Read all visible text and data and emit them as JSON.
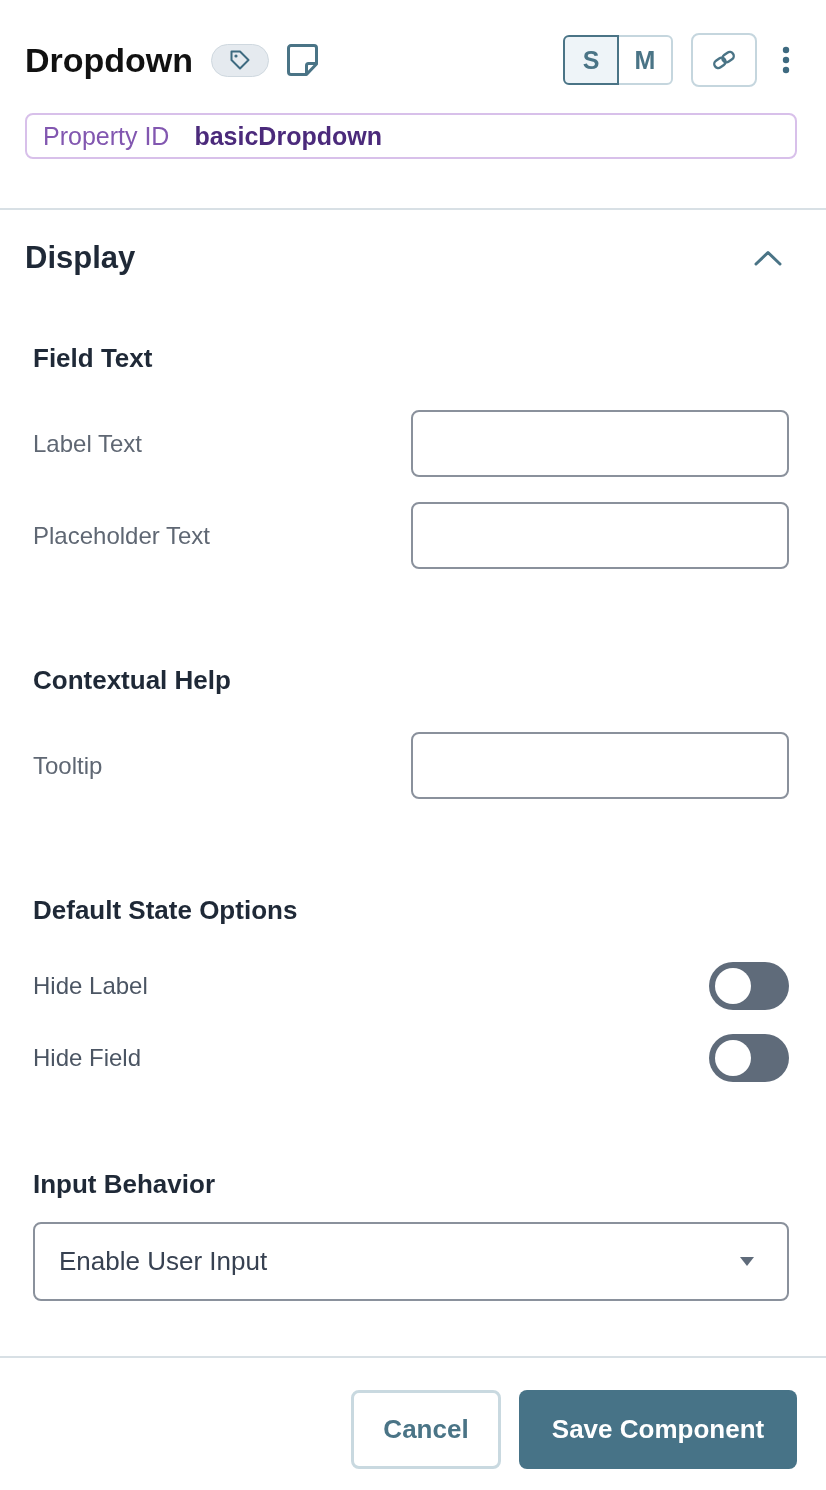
{
  "header": {
    "title": "Dropdown",
    "size_options": [
      {
        "label": "S",
        "selected": true
      },
      {
        "label": "M",
        "selected": false
      }
    ]
  },
  "property_id": {
    "label": "Property ID",
    "value": "basicDropdown"
  },
  "section": {
    "title": "Display",
    "expanded": true
  },
  "groups": [
    {
      "title": "Field Text",
      "rows": [
        {
          "kind": "text",
          "label": "Label Text"
        },
        {
          "kind": "text",
          "label": "Placeholder Text"
        }
      ]
    },
    {
      "title": "Contextual Help",
      "rows": [
        {
          "kind": "text",
          "label": "Tooltip"
        }
      ]
    },
    {
      "title": "Default State Options",
      "rows": [
        {
          "kind": "toggle",
          "label": "Hide Label",
          "on": false
        },
        {
          "kind": "toggle",
          "label": "Hide Field",
          "on": false
        }
      ]
    },
    {
      "title": "Input Behavior",
      "rows": [
        {
          "kind": "select",
          "value": "Enable User Input"
        }
      ]
    }
  ],
  "footer": {
    "buttons": [
      {
        "kind": "secondary",
        "label": "Cancel"
      },
      {
        "kind": "primary",
        "label": "Save Component"
      }
    ]
  }
}
